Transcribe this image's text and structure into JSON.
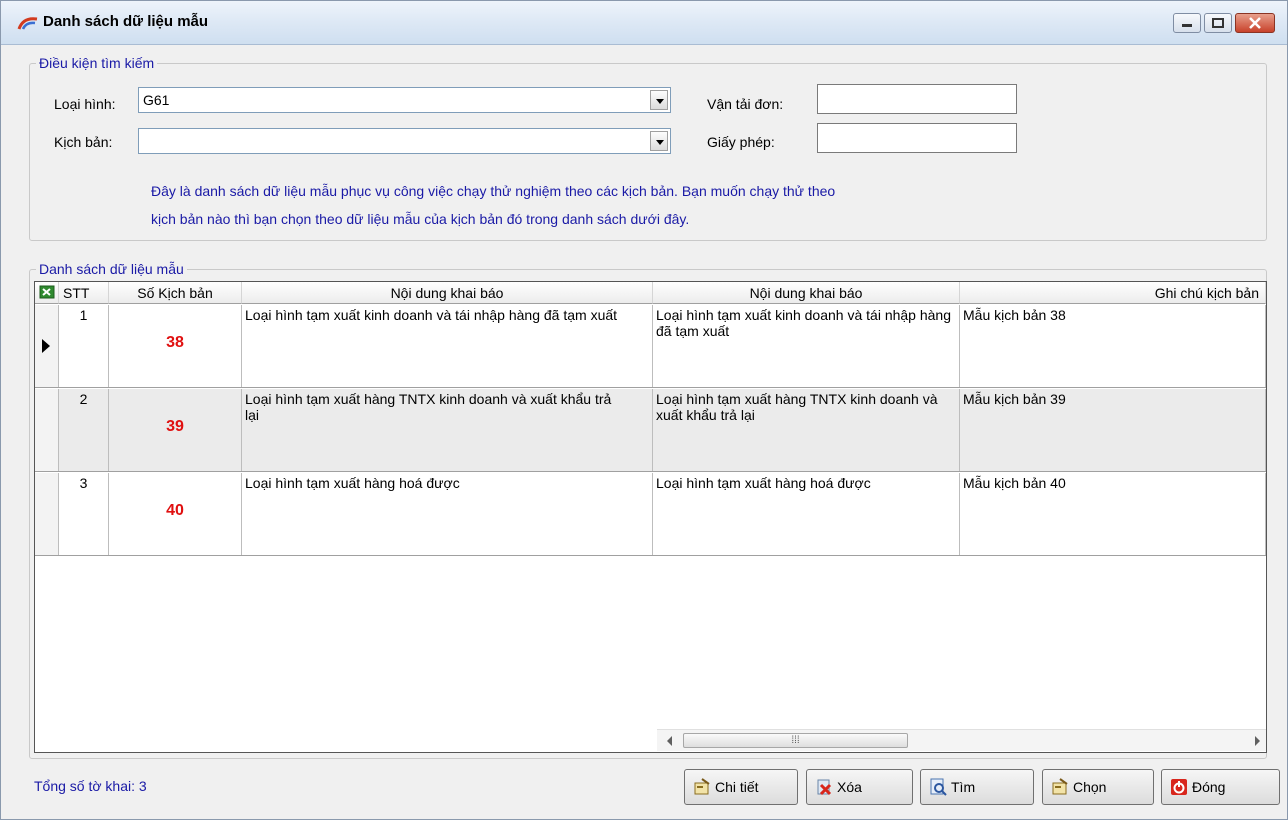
{
  "window": {
    "title": "Danh sách dữ liệu mẫu"
  },
  "search": {
    "legend": "Điều kiện tìm kiếm",
    "loai_hinh_label": "Loại hình:",
    "loai_hinh_value": "G61",
    "kich_ban_label": "Kịch bản:",
    "kich_ban_value": "",
    "van_tai_don_label": "Vận tải đơn:",
    "van_tai_don_value": "",
    "giay_phep_label": "Giấy phép:",
    "giay_phep_value": "",
    "info_line1": "Đây là danh sách dữ liệu mẫu phục vụ công việc chạy thử nghiệm theo các kịch bản. Bạn muốn chạy thử theo",
    "info_line2": "kịch bản nào thì bạn chọn theo dữ liệu mẫu của kịch bản đó trong danh sách dưới đây."
  },
  "list": {
    "legend": "Danh sách dữ liệu mẫu",
    "columns": [
      "STT",
      "Số Kịch bản",
      "Nội dung khai báo",
      "Nội dung khai báo",
      "Ghi chú kịch bản"
    ],
    "rows": [
      {
        "stt": "1",
        "kb": "38",
        "nd1": "Loại hình tạm xuất kinh doanh và tái nhập hàng đã tạm xuất",
        "nd2": "Loại hình tạm xuất kinh doanh và tái nhập hàng đã tạm xuất",
        "note": "Mẫu kịch bản 38"
      },
      {
        "stt": "2",
        "kb": "39",
        "nd1": "Loại hình tạm xuất hàng TNTX kinh doanh và xuất khẩu trả lại",
        "nd2": "Loại hình tạm xuất hàng TNTX kinh doanh và xuất khẩu trả lại",
        "note": "Mẫu kịch bản 39"
      },
      {
        "stt": "3",
        "kb": "40",
        "nd1": "Loại hình tạm xuất hàng hoá được",
        "nd2": "Loại hình tạm xuất hàng hoá được",
        "note": "Mẫu kịch bản 40"
      }
    ]
  },
  "footer": {
    "total_label": "Tổng số tờ khai: 3",
    "buttons": {
      "detail": "Chi tiết",
      "delete": "Xóa",
      "find": "Tìm",
      "select": "Chọn",
      "close": "Đóng"
    }
  },
  "icons": [
    "app-icon",
    "excel-icon",
    "row-pointer-icon",
    "detail-icon",
    "delete-icon",
    "find-icon",
    "select-icon",
    "close-icon"
  ]
}
